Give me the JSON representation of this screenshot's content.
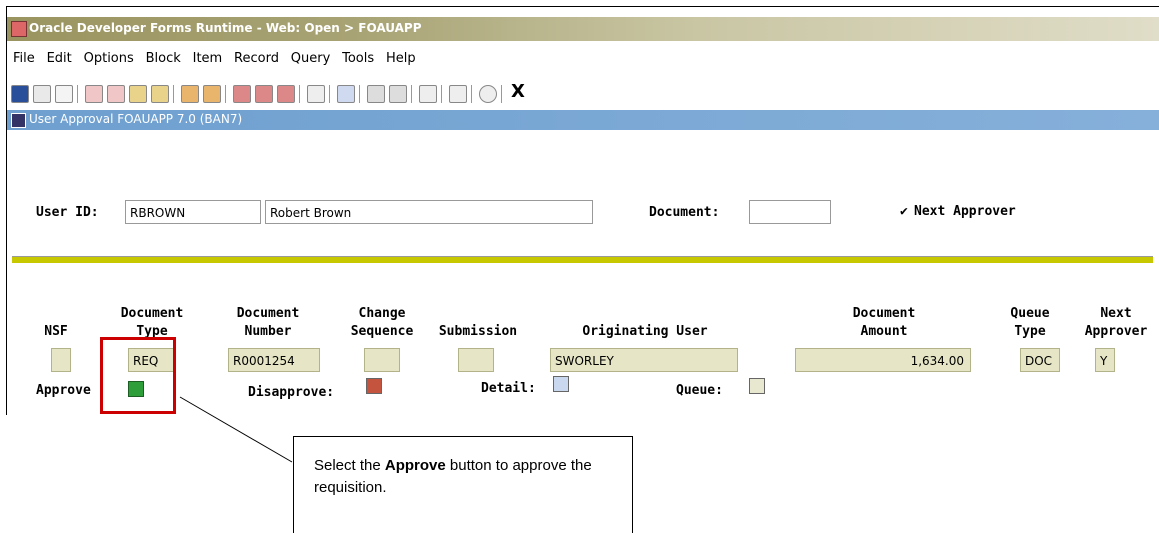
{
  "window": {
    "title": "Oracle Developer Forms Runtime - Web:  Open > FOAUAPP",
    "menu": [
      "File",
      "Edit",
      "Options",
      "Block",
      "Item",
      "Record",
      "Query",
      "Tools",
      "Help"
    ],
    "toolbar_exit": "X"
  },
  "form": {
    "title": "User Approval  FOAUAPP  7.0  (BAN7)",
    "user_id_label": "User ID:",
    "user_id_value": "RBROWN",
    "user_name_value": "Robert Brown",
    "document_label": "Document:",
    "document_value": "",
    "next_approver_checkbox": "✔",
    "next_approver_label": "Next Approver"
  },
  "grid": {
    "headers": {
      "nsf": "NSF",
      "doc_type_1": "Document",
      "doc_type_2": "Type",
      "doc_number_1": "Document",
      "doc_number_2": "Number",
      "change_seq_1": "Change",
      "change_seq_2": "Sequence",
      "submission": "Submission",
      "originating_user": "Originating User",
      "doc_amount_1": "Document",
      "doc_amount_2": "Amount",
      "queue_type_1": "Queue",
      "queue_type_2": "Type",
      "next_approver_1": "Next",
      "next_approver_2": "Approver"
    },
    "row": {
      "nsf": "",
      "doc_type": "REQ",
      "doc_number": "R0001254",
      "change_seq": "",
      "submission": "",
      "originating_user": "SWORLEY",
      "doc_amount": "1,634.00",
      "queue_type": "DOC",
      "next_approver": "Y"
    },
    "approve_label": "Approve",
    "disapprove_label": "Disapprove:",
    "detail_label": "Detail:",
    "queue_label": "Queue:"
  },
  "callout": {
    "text_before": "Select the ",
    "bold": "Approve",
    "text_after": " button to approve the requisition."
  },
  "colors": {
    "highlight": "#cc0000",
    "divider": "#c8c800",
    "readonly_field": "#e6e6c6"
  }
}
